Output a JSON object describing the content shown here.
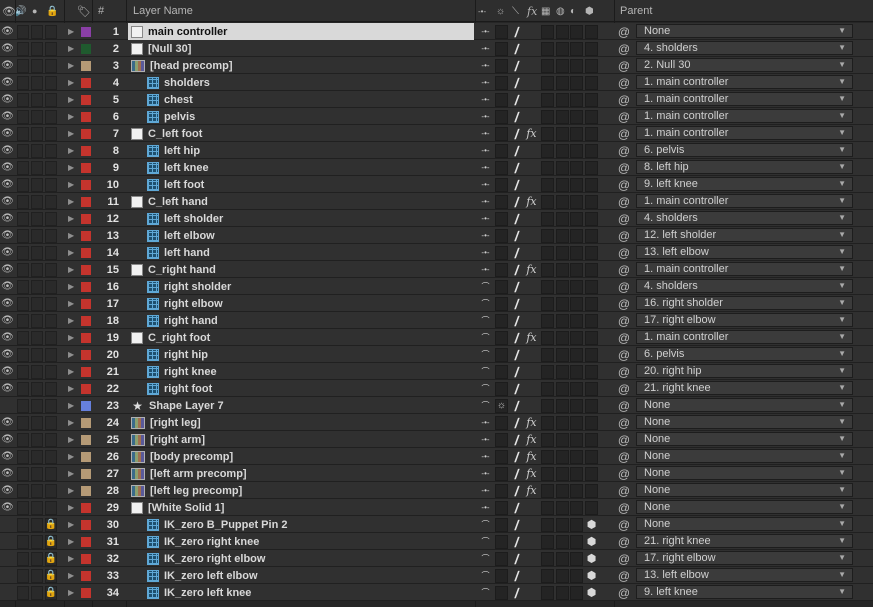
{
  "header": {
    "layer_name": "Layer Name",
    "hash": "#",
    "parent": "Parent",
    "icons": [
      "eye-icon",
      "speaker-icon",
      "solo-icon",
      "lock-icon",
      "label-tag-icon",
      "shy-icon",
      "collapse-icon",
      "quality-icon",
      "fx-icon",
      "frame-blend-icon",
      "motion-blur-icon",
      "adjustment-icon",
      "3d-icon"
    ]
  },
  "colors": {
    "purple": "#8a3fa6",
    "darkgreen": "#1f5a2e",
    "tan": "#b59a76",
    "red": "#c4342d",
    "blue": "#6680dd"
  },
  "layers": [
    {
      "num": "1",
      "name": "main controller",
      "type": "solid",
      "label": "purple",
      "parent": "None",
      "eye": true,
      "lock": false,
      "shy": true,
      "fx": false,
      "three_d": false,
      "selected": true
    },
    {
      "num": "2",
      "name": "[Null 30]",
      "type": "solid",
      "label": "darkgreen",
      "parent": "4. sholders",
      "eye": true,
      "lock": false,
      "shy": true,
      "fx": false,
      "three_d": false
    },
    {
      "num": "3",
      "name": "[head precomp]",
      "type": "comp",
      "label": "tan",
      "parent": "2. Null 30",
      "eye": true,
      "lock": false,
      "shy": true,
      "fx": false,
      "three_d": false
    },
    {
      "num": "4",
      "name": "sholders",
      "type": "pin",
      "label": "red",
      "parent": "1. main controller",
      "eye": true,
      "lock": false,
      "shy": true,
      "fx": false,
      "three_d": false
    },
    {
      "num": "5",
      "name": "chest",
      "type": "pin",
      "label": "red",
      "parent": "1. main controller",
      "eye": true,
      "lock": false,
      "shy": true,
      "fx": false,
      "three_d": false
    },
    {
      "num": "6",
      "name": "pelvis",
      "type": "pin",
      "label": "red",
      "parent": "1. main controller",
      "eye": true,
      "lock": false,
      "shy": true,
      "fx": false,
      "three_d": false
    },
    {
      "num": "7",
      "name": "C_left foot",
      "type": "solid",
      "label": "red",
      "parent": "1. main controller",
      "eye": true,
      "lock": false,
      "shy": true,
      "fx": true,
      "three_d": false
    },
    {
      "num": "8",
      "name": "left hip",
      "type": "pin",
      "label": "red",
      "parent": "6. pelvis",
      "eye": true,
      "lock": false,
      "shy": true,
      "fx": false,
      "three_d": false
    },
    {
      "num": "9",
      "name": "left knee",
      "type": "pin",
      "label": "red",
      "parent": "8. left hip",
      "eye": true,
      "lock": false,
      "shy": true,
      "fx": false,
      "three_d": false
    },
    {
      "num": "10",
      "name": "left foot",
      "type": "pin",
      "label": "red",
      "parent": "9. left knee",
      "eye": true,
      "lock": false,
      "shy": true,
      "fx": false,
      "three_d": false
    },
    {
      "num": "11",
      "name": "C_left hand",
      "type": "solid",
      "label": "red",
      "parent": "1. main controller",
      "eye": true,
      "lock": false,
      "shy": true,
      "fx": true,
      "three_d": false
    },
    {
      "num": "12",
      "name": "left sholder",
      "type": "pin",
      "label": "red",
      "parent": "4. sholders",
      "eye": true,
      "lock": false,
      "shy": true,
      "fx": false,
      "three_d": false
    },
    {
      "num": "13",
      "name": "left elbow",
      "type": "pin",
      "label": "red",
      "parent": "12. left sholder",
      "eye": true,
      "lock": false,
      "shy": true,
      "fx": false,
      "three_d": false
    },
    {
      "num": "14",
      "name": "left hand",
      "type": "pin",
      "label": "red",
      "parent": "13. left elbow",
      "eye": true,
      "lock": false,
      "shy": true,
      "fx": false,
      "three_d": false
    },
    {
      "num": "15",
      "name": "C_right hand",
      "type": "solid",
      "label": "red",
      "parent": "1. main controller",
      "eye": true,
      "lock": false,
      "shy": true,
      "fx": true,
      "three_d": false
    },
    {
      "num": "16",
      "name": "right sholder",
      "type": "pin",
      "label": "red",
      "parent": "4. sholders",
      "eye": true,
      "lock": false,
      "shy": false,
      "fx": false,
      "three_d": false
    },
    {
      "num": "17",
      "name": "right elbow",
      "type": "pin",
      "label": "red",
      "parent": "16. right sholder",
      "eye": true,
      "lock": false,
      "shy": false,
      "fx": false,
      "three_d": false
    },
    {
      "num": "18",
      "name": "right hand",
      "type": "pin",
      "label": "red",
      "parent": "17. right elbow",
      "eye": true,
      "lock": false,
      "shy": false,
      "fx": false,
      "three_d": false
    },
    {
      "num": "19",
      "name": "C_right foot",
      "type": "solid",
      "label": "red",
      "parent": "1. main controller",
      "eye": true,
      "lock": false,
      "shy": false,
      "fx": true,
      "three_d": false
    },
    {
      "num": "20",
      "name": "right hip",
      "type": "pin",
      "label": "red",
      "parent": "6. pelvis",
      "eye": true,
      "lock": false,
      "shy": false,
      "fx": false,
      "three_d": false
    },
    {
      "num": "21",
      "name": "right knee",
      "type": "pin",
      "label": "red",
      "parent": "20. right hip",
      "eye": true,
      "lock": false,
      "shy": false,
      "fx": false,
      "three_d": false
    },
    {
      "num": "22",
      "name": "right foot",
      "type": "pin",
      "label": "red",
      "parent": "21. right knee",
      "eye": true,
      "lock": false,
      "shy": false,
      "fx": false,
      "three_d": false
    },
    {
      "num": "23",
      "name": "Shape Layer 7",
      "type": "shape",
      "label": "blue",
      "parent": "None",
      "eye": false,
      "lock": false,
      "shy": false,
      "fx": false,
      "three_d": false
    },
    {
      "num": "24",
      "name": "[right leg]",
      "type": "comp",
      "label": "tan",
      "parent": "None",
      "eye": true,
      "lock": false,
      "shy": true,
      "fx": true,
      "three_d": false
    },
    {
      "num": "25",
      "name": "[right arm]",
      "type": "comp",
      "label": "tan",
      "parent": "None",
      "eye": true,
      "lock": false,
      "shy": true,
      "fx": true,
      "three_d": false
    },
    {
      "num": "26",
      "name": "[body precomp]",
      "type": "comp",
      "label": "tan",
      "parent": "None",
      "eye": true,
      "lock": false,
      "shy": true,
      "fx": true,
      "three_d": false
    },
    {
      "num": "27",
      "name": "[left arm precomp]",
      "type": "comp",
      "label": "tan",
      "parent": "None",
      "eye": true,
      "lock": false,
      "shy": true,
      "fx": true,
      "three_d": false
    },
    {
      "num": "28",
      "name": "[left leg precomp]",
      "type": "comp",
      "label": "tan",
      "parent": "None",
      "eye": true,
      "lock": false,
      "shy": true,
      "fx": true,
      "three_d": false
    },
    {
      "num": "29",
      "name": "[White Solid 1]",
      "type": "solid",
      "label": "red",
      "parent": "None",
      "eye": true,
      "lock": false,
      "shy": true,
      "fx": false,
      "three_d": false
    },
    {
      "num": "30",
      "name": "IK_zero B_Puppet Pin 2",
      "type": "pin",
      "label": "red",
      "parent": "None",
      "eye": false,
      "lock": true,
      "shy": false,
      "fx": false,
      "three_d": true
    },
    {
      "num": "31",
      "name": "IK_zero right knee",
      "type": "pin",
      "label": "red",
      "parent": "21. right knee",
      "eye": false,
      "lock": true,
      "shy": false,
      "fx": false,
      "three_d": true
    },
    {
      "num": "32",
      "name": "IK_zero right elbow",
      "type": "pin",
      "label": "red",
      "parent": "17. right elbow",
      "eye": false,
      "lock": true,
      "shy": false,
      "fx": false,
      "three_d": true
    },
    {
      "num": "33",
      "name": "IK_zero left elbow",
      "type": "pin",
      "label": "red",
      "parent": "13. left elbow",
      "eye": false,
      "lock": true,
      "shy": false,
      "fx": false,
      "three_d": true
    },
    {
      "num": "34",
      "name": "IK_zero left knee",
      "type": "pin",
      "label": "red",
      "parent": "9. left knee",
      "eye": false,
      "lock": true,
      "shy": false,
      "fx": false,
      "three_d": true
    }
  ]
}
